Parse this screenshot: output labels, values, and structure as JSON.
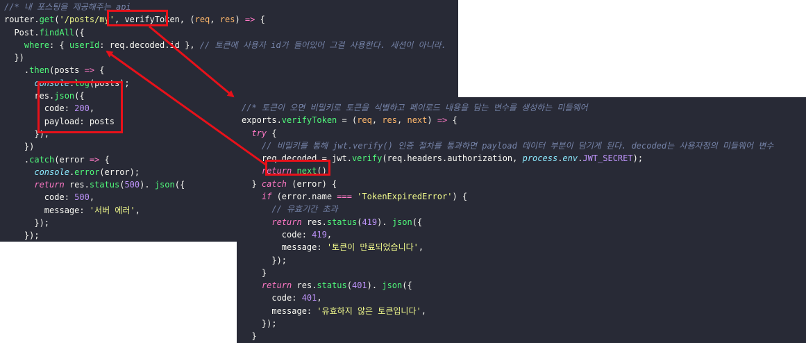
{
  "left_code": {
    "lines": [
      [
        [
          "comment",
          "//* 내 포스팅을 제공해주는 api"
        ]
      ],
      [
        [
          "plain",
          "router."
        ],
        [
          "fn",
          "get"
        ],
        [
          "plain",
          "("
        ],
        [
          "str",
          "'/posts/my'"
        ],
        [
          "plain",
          ", "
        ],
        [
          "plain",
          "verifyToken"
        ],
        [
          "plain",
          ", ("
        ],
        [
          "param",
          "req"
        ],
        [
          "plain",
          ", "
        ],
        [
          "param",
          "res"
        ],
        [
          "plain",
          ") "
        ],
        [
          "kw",
          "=>"
        ],
        [
          "plain",
          " {"
        ]
      ],
      [
        [
          "plain",
          "  Post."
        ],
        [
          "fn",
          "findAll"
        ],
        [
          "plain",
          "({"
        ]
      ],
      [
        [
          "plain",
          "    "
        ],
        [
          "fn",
          "where"
        ],
        [
          "plain",
          ": { "
        ],
        [
          "fn",
          "userId"
        ],
        [
          "plain",
          ": req.decoded.id },"
        ],
        [
          "comment",
          " // 토큰에 사용자 id가 들어있어 그걸 사용한다. 세션이 아니라."
        ]
      ],
      [
        [
          "plain",
          "  })"
        ]
      ],
      [
        [
          "plain",
          "    ."
        ],
        [
          "fn",
          "then"
        ],
        [
          "plain",
          "(posts "
        ],
        [
          "kw",
          "=>"
        ],
        [
          "plain",
          " {"
        ]
      ],
      [
        [
          "plain",
          "      "
        ],
        [
          "builtin",
          "console"
        ],
        [
          "plain",
          "."
        ],
        [
          "fn",
          "log"
        ],
        [
          "plain",
          "(posts);"
        ]
      ],
      [
        [
          "plain",
          "      res."
        ],
        [
          "fn",
          "json"
        ],
        [
          "plain",
          "({"
        ]
      ],
      [
        [
          "plain",
          "        "
        ],
        [
          "plain",
          "code: "
        ],
        [
          "num",
          "200"
        ],
        [
          "plain",
          ","
        ]
      ],
      [
        [
          "plain",
          "        "
        ],
        [
          "plain",
          "payload: posts"
        ]
      ],
      [
        [
          "plain",
          "      });"
        ]
      ],
      [
        [
          "plain",
          "    })"
        ]
      ],
      [
        [
          "plain",
          "    ."
        ],
        [
          "fn",
          "catch"
        ],
        [
          "plain",
          "(error "
        ],
        [
          "kw",
          "=>"
        ],
        [
          "plain",
          " {"
        ]
      ],
      [
        [
          "plain",
          "      "
        ],
        [
          "builtin",
          "console"
        ],
        [
          "plain",
          "."
        ],
        [
          "fn",
          "error"
        ],
        [
          "plain",
          "(error);"
        ]
      ],
      [
        [
          "plain",
          "      "
        ],
        [
          "kw-i",
          "return"
        ],
        [
          "plain",
          " res."
        ],
        [
          "fn",
          "status"
        ],
        [
          "plain",
          "("
        ],
        [
          "num",
          "500"
        ],
        [
          "plain",
          "). "
        ],
        [
          "fn",
          "json"
        ],
        [
          "plain",
          "({"
        ]
      ],
      [
        [
          "plain",
          "        code: "
        ],
        [
          "num",
          "500"
        ],
        [
          "plain",
          ","
        ]
      ],
      [
        [
          "plain",
          "        message: "
        ],
        [
          "str",
          "'서버 에러'"
        ],
        [
          "plain",
          ","
        ]
      ],
      [
        [
          "plain",
          "      });"
        ]
      ],
      [
        [
          "plain",
          "    });"
        ]
      ],
      [
        [
          "plain",
          "});"
        ]
      ]
    ]
  },
  "right_code": {
    "lines": [
      [
        [
          "comment",
          "//* 토큰이 오면 비밀키로 토큰을 식별하고 페이로드 내용을 담는 변수를 생성하는 미들웨어"
        ]
      ],
      [
        [
          "plain",
          "exports."
        ],
        [
          "fn",
          "verifyToken"
        ],
        [
          "plain",
          " = ("
        ],
        [
          "param",
          "req"
        ],
        [
          "plain",
          ", "
        ],
        [
          "param",
          "res"
        ],
        [
          "plain",
          ", "
        ],
        [
          "param",
          "next"
        ],
        [
          "plain",
          ") "
        ],
        [
          "kw",
          "=>"
        ],
        [
          "plain",
          " {"
        ]
      ],
      [
        [
          "plain",
          "  "
        ],
        [
          "kw-i",
          "try"
        ],
        [
          "plain",
          " {"
        ]
      ],
      [
        [
          "comment",
          "    // 비밀키를 통해 jwt.verify() 인증 절차를 통과하면 payload 데이터 부분이 담기게 된다. decoded는 사용자정의 미들웨어 변수"
        ]
      ],
      [
        [
          "plain",
          "    req.decoded = jwt."
        ],
        [
          "fn",
          "verify"
        ],
        [
          "plain",
          "(req.headers.authorization, "
        ],
        [
          "builtin",
          "process"
        ],
        [
          "plain",
          "."
        ],
        [
          "builtin",
          "env"
        ],
        [
          "plain",
          "."
        ],
        [
          "const",
          "JWT_SECRET"
        ],
        [
          "plain",
          ");"
        ]
      ],
      [
        [
          "plain",
          "    "
        ],
        [
          "kw-i",
          "return"
        ],
        [
          "plain",
          " "
        ],
        [
          "fn",
          "next"
        ],
        [
          "plain",
          "();"
        ]
      ],
      [
        [
          "plain",
          "  } "
        ],
        [
          "kw-i",
          "catch"
        ],
        [
          "plain",
          " (error) {"
        ]
      ],
      [
        [
          "plain",
          "    "
        ],
        [
          "kw-i",
          "if"
        ],
        [
          "plain",
          " (error.name "
        ],
        [
          "kw",
          "==="
        ],
        [
          "plain",
          " "
        ],
        [
          "str",
          "'TokenExpiredError'"
        ],
        [
          "plain",
          ") {"
        ]
      ],
      [
        [
          "comment",
          "      // 유효기간 초과"
        ]
      ],
      [
        [
          "plain",
          "      "
        ],
        [
          "kw-i",
          "return"
        ],
        [
          "plain",
          " res."
        ],
        [
          "fn",
          "status"
        ],
        [
          "plain",
          "("
        ],
        [
          "num",
          "419"
        ],
        [
          "plain",
          "). "
        ],
        [
          "fn",
          "json"
        ],
        [
          "plain",
          "({"
        ]
      ],
      [
        [
          "plain",
          "        code: "
        ],
        [
          "num",
          "419"
        ],
        [
          "plain",
          ","
        ]
      ],
      [
        [
          "plain",
          "        message: "
        ],
        [
          "str",
          "'토큰이 만료되었습니다'"
        ],
        [
          "plain",
          ","
        ]
      ],
      [
        [
          "plain",
          "      });"
        ]
      ],
      [
        [
          "plain",
          "    }"
        ]
      ],
      [
        [
          "plain",
          "    "
        ],
        [
          "kw-i",
          "return"
        ],
        [
          "plain",
          " res."
        ],
        [
          "fn",
          "status"
        ],
        [
          "plain",
          "("
        ],
        [
          "num",
          "401"
        ],
        [
          "plain",
          "). "
        ],
        [
          "fn",
          "json"
        ],
        [
          "plain",
          "({"
        ]
      ],
      [
        [
          "plain",
          "      code: "
        ],
        [
          "num",
          "401"
        ],
        [
          "plain",
          ","
        ]
      ],
      [
        [
          "plain",
          "      message: "
        ],
        [
          "str",
          "'유효하지 않은 토큰입니다'"
        ],
        [
          "plain",
          ","
        ]
      ],
      [
        [
          "plain",
          "    });"
        ]
      ],
      [
        [
          "plain",
          "  }"
        ]
      ],
      [
        [
          "plain",
          "};"
        ]
      ]
    ]
  },
  "colors": {
    "editor_bg": "#282a36",
    "highlight_box": "#e8111a",
    "arrow": "#e8111a"
  }
}
